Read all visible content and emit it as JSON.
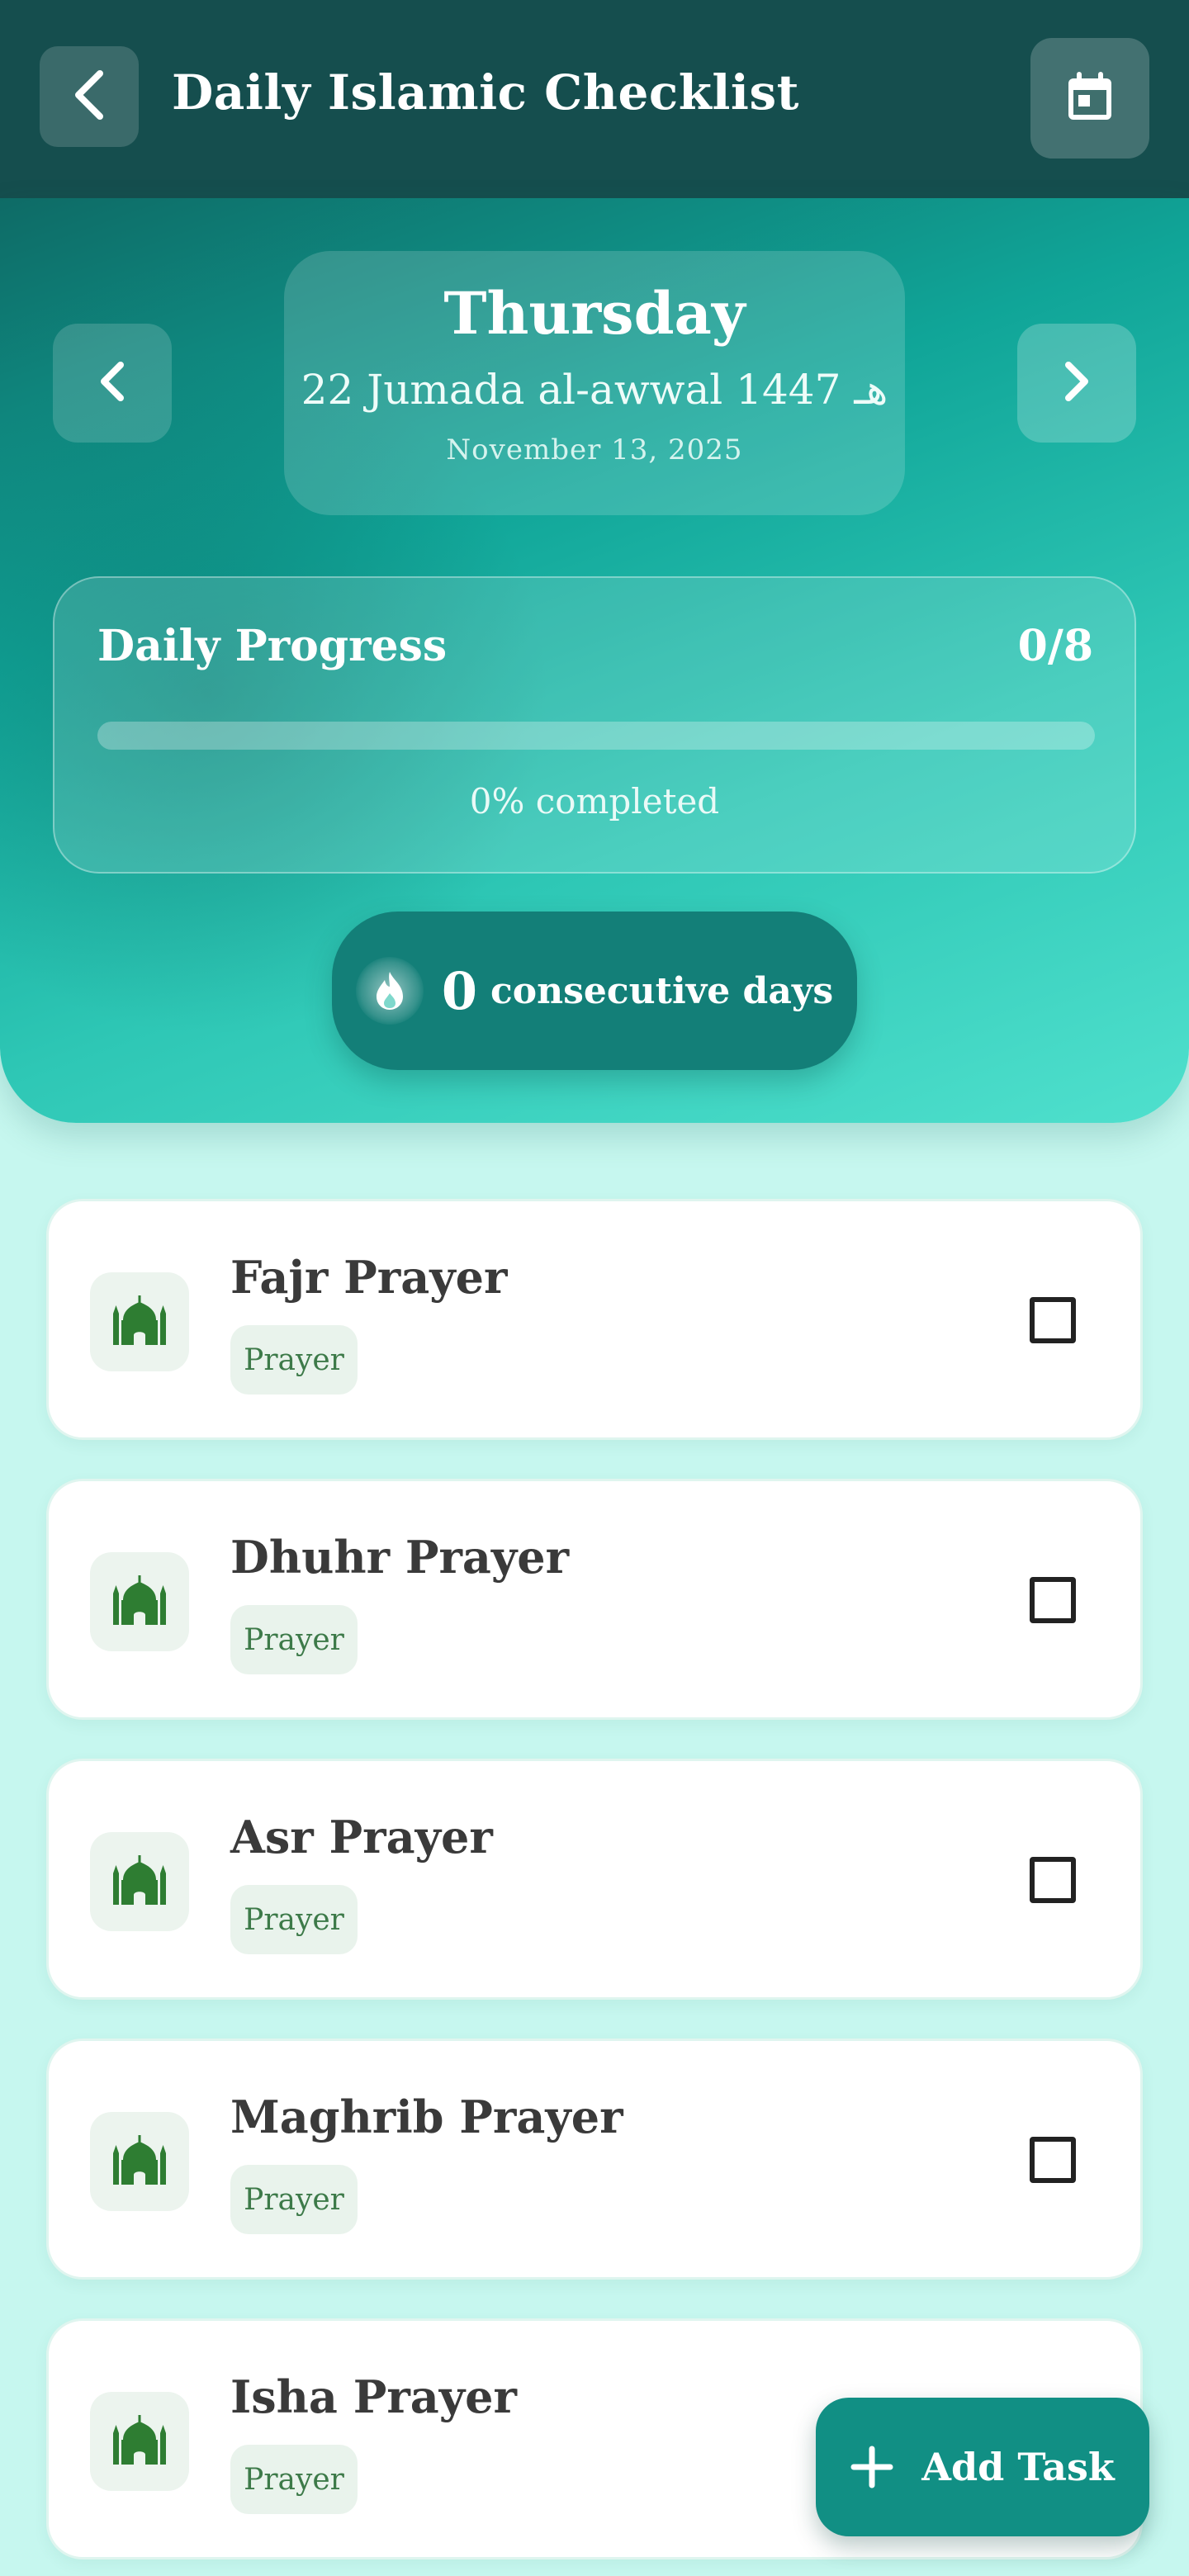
{
  "header": {
    "title": "Daily Islamic Checklist",
    "back_icon": "chevron-left-icon",
    "calendar_icon": "calendar-icon"
  },
  "date": {
    "weekday": "Thursday",
    "hijri": "22 Jumada al-awwal 1447 هـ",
    "gregorian": "November 13, 2025"
  },
  "progress": {
    "title": "Daily Progress",
    "count": "0/8",
    "completed_text": "0% completed",
    "fraction": 0
  },
  "streak": {
    "value": "0",
    "label": "consecutive days"
  },
  "tasks": [
    {
      "title": "Fajr Prayer",
      "tag": "Prayer",
      "icon": "mosque-icon",
      "checked": false
    },
    {
      "title": "Dhuhr Prayer",
      "tag": "Prayer",
      "icon": "mosque-icon",
      "checked": false
    },
    {
      "title": "Asr Prayer",
      "tag": "Prayer",
      "icon": "mosque-icon",
      "checked": false
    },
    {
      "title": "Maghrib Prayer",
      "tag": "Prayer",
      "icon": "mosque-icon",
      "checked": false
    },
    {
      "title": "Isha Prayer",
      "tag": "Prayer",
      "icon": "mosque-icon",
      "checked": false
    }
  ],
  "fab": {
    "label": "Add Task"
  },
  "colors": {
    "header_bg": "#154e4e",
    "accent": "#118f84",
    "mosque_green": "#2e7d32",
    "page_bg": "#c6f7ef"
  }
}
